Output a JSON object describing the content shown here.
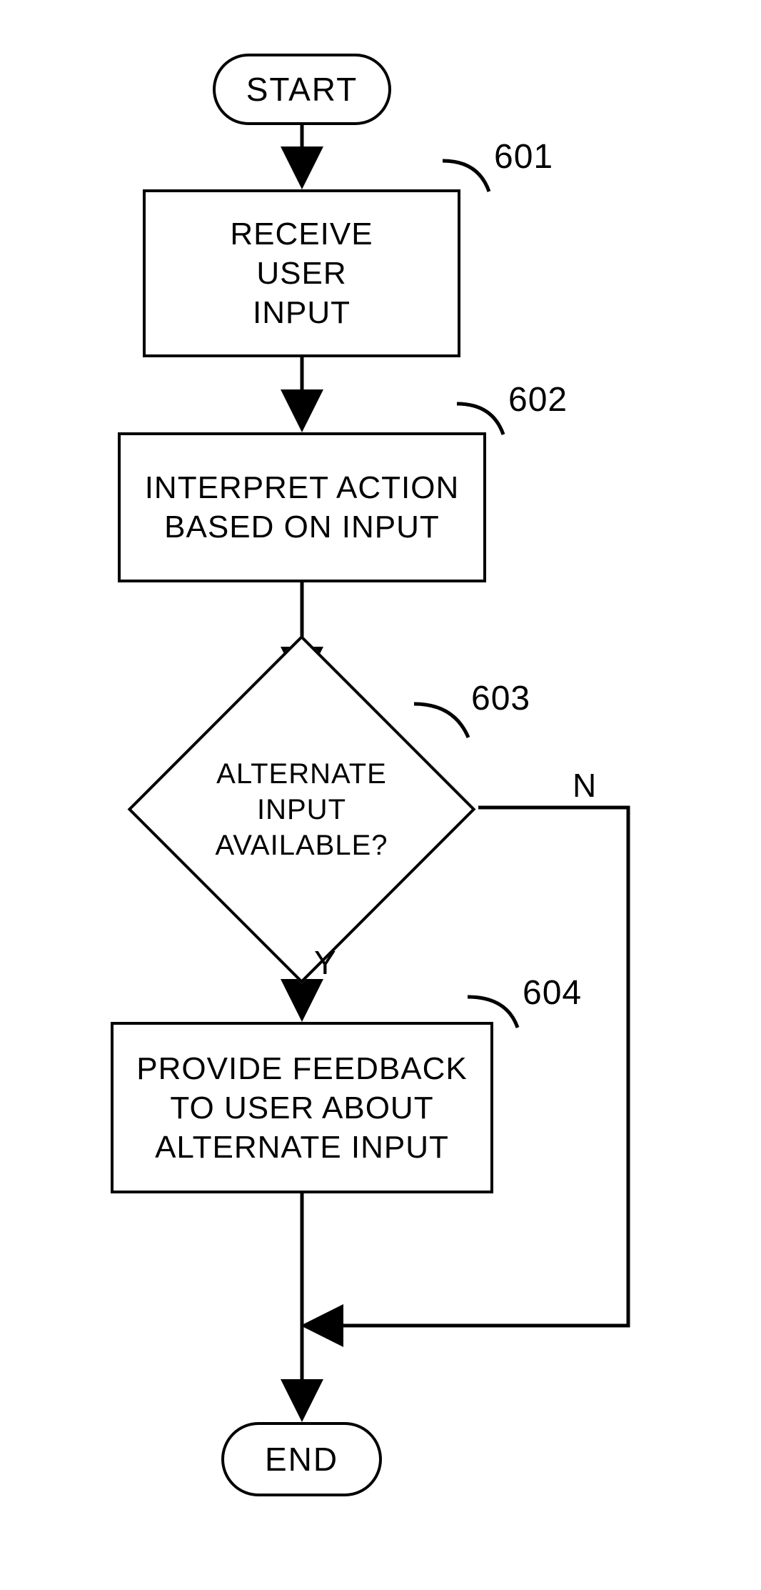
{
  "flowchart": {
    "start": "START",
    "end": "END",
    "steps": {
      "s601": {
        "ref": "601",
        "text": "RECEIVE\nUSER\nINPUT"
      },
      "s602": {
        "ref": "602",
        "text": "INTERPRET ACTION\nBASED ON INPUT"
      },
      "s603": {
        "ref": "603",
        "text": "ALTERNATE\nINPUT\nAVAILABLE?",
        "yes": "Y",
        "no": "N"
      },
      "s604": {
        "ref": "604",
        "text": "PROVIDE FEEDBACK\nTO USER ABOUT\nALTERNATE INPUT"
      }
    }
  }
}
